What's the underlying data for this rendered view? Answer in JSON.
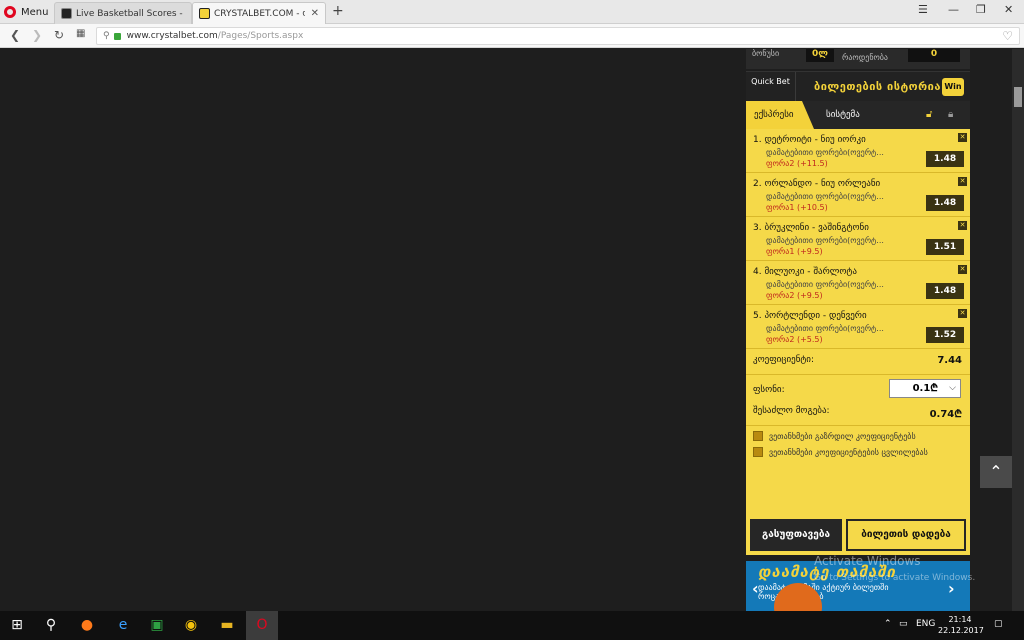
{
  "browser": {
    "menu_label": "Menu",
    "tabs": [
      {
        "title": "Live Basketball Scores - NBA",
        "active": false
      },
      {
        "title": "CRYSTALBET.COM - ონლაინ",
        "active": true
      }
    ],
    "url_domain": "www.crystalbet.com",
    "url_path": "/Pages/Sports.aspx"
  },
  "betslip": {
    "top_left_label": "ბონუსი",
    "top_left_value": "0ლ",
    "top_right_label": "რაოდენობა",
    "top_right_value": "0",
    "quick_bet": "Quick Bet",
    "history": "ბილეთების ისტორია",
    "win_badge": "Win",
    "tab_express": "ექსპრესი",
    "tab_system": "სისტემა",
    "bets": [
      {
        "title": "1. დეტროიტი - ნიუ იორკი",
        "type": "დამატებითი ფორები(ოვერტ...",
        "handicap": "ფორა2 (+11.5)",
        "odd": "1.48"
      },
      {
        "title": "2. ორლანდო - ნიუ ორლეანი",
        "type": "დამატებითი ფორები(ოვერტ...",
        "handicap": "ფორა1 (+10.5)",
        "odd": "1.48"
      },
      {
        "title": "3. ბრუკლინი - ვაშინგტონი",
        "type": "დამატებითი ფორები(ოვერტ...",
        "handicap": "ფორა1 (+9.5)",
        "odd": "1.51"
      },
      {
        "title": "4. მილუოკი - შარლოტა",
        "type": "დამატებითი ფორები(ოვერტ...",
        "handicap": "ფორა2 (+9.5)",
        "odd": "1.48"
      },
      {
        "title": "5. პორტლენდი - დენვერი",
        "type": "დამატებითი ფორები(ოვერტ...",
        "handicap": "ფორა2 (+5.5)",
        "odd": "1.52"
      }
    ],
    "coef_label": "კოეფიციენტი:",
    "coef_value": "7.44",
    "stake_label": "ფსონი:",
    "stake_value": "0.1",
    "possible_label": "შესაძლო მოგება:",
    "possible_value": "0.74",
    "currency_symbol": "₾",
    "checkbox1": "ვეთანხმები გაზრდილ კოეფიციენტებს",
    "checkbox2": "ვეთანხმები კოეფიციენტების ცვლილებას",
    "btn_clear": "გასუფთავება",
    "btn_place": "ბილეთის დადება",
    "banner_title": "დაამატე თამაში",
    "banner_sub_1": "დაამატე თამაში აქტიურ ბილეთში",
    "banner_sub_2": "როცა მოისურვებ"
  },
  "watermark": {
    "line1": "Activate Windows",
    "line2": "Go to Settings to activate Windows."
  },
  "taskbar": {
    "lang": "ENG",
    "time": "21:14",
    "date": "22.12.2017"
  }
}
